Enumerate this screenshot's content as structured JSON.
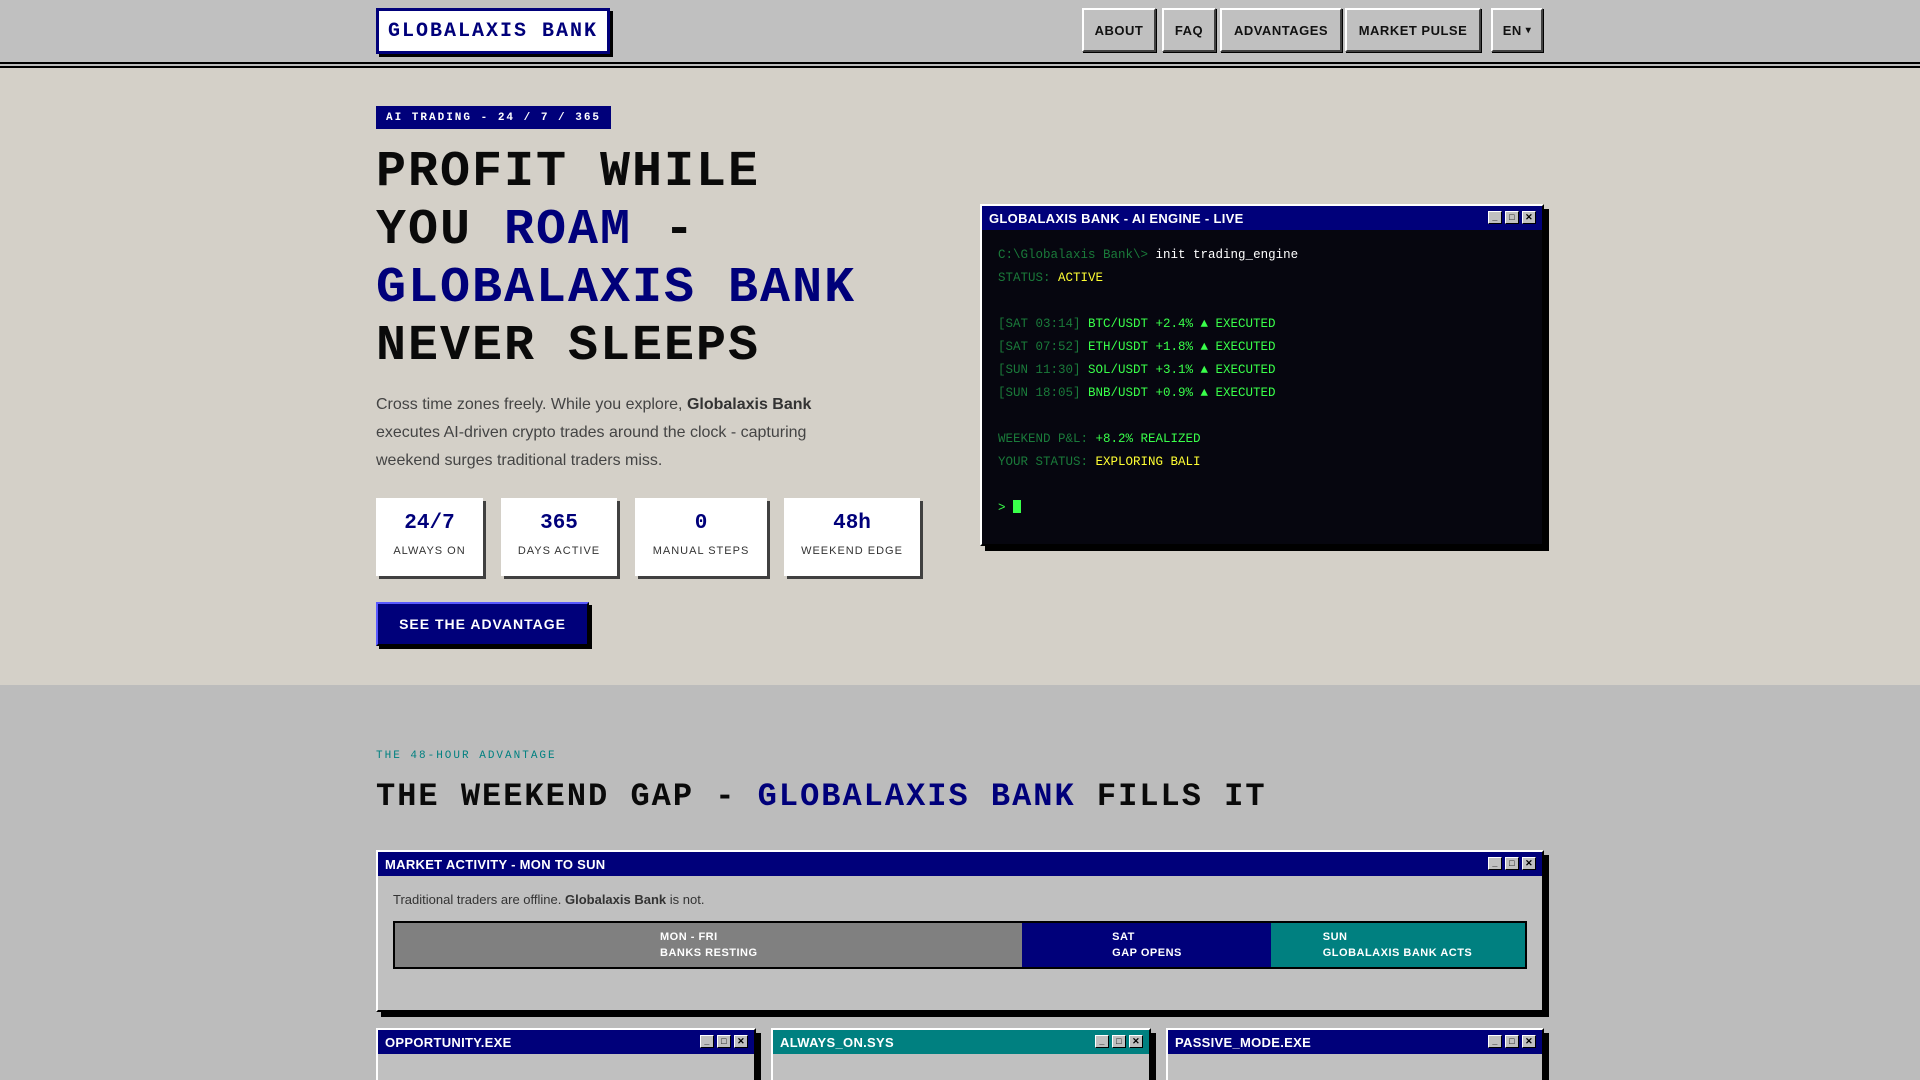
{
  "nav": {
    "logo": "GLOBALAXIS BANK",
    "items": [
      "ABOUT",
      "FAQ",
      "ADVANTAGES",
      "MARKET PULSE"
    ],
    "lang": "EN",
    "lang_arrow": "▾"
  },
  "hero": {
    "tag": "AI TRADING - 24 / 7 / 365",
    "title": {
      "l1": "PROFIT WHILE",
      "l2a": "YOU ",
      "l2b": "ROAM",
      "l2c": " -",
      "l3": "GLOBALAXIS BANK",
      "l4": "NEVER SLEEPS"
    },
    "lead": {
      "a": "Cross time zones freely. While you explore, ",
      "b": "Globalaxis Bank",
      "c": " executes AI-driven crypto trades around the clock - capturing weekend surges traditional traders miss."
    },
    "stats": [
      {
        "value": "24/7",
        "label": "ALWAYS ON"
      },
      {
        "value": "365",
        "label": "DAYS ACTIVE"
      },
      {
        "value": "0",
        "label": "MANUAL STEPS"
      },
      {
        "value": "48h",
        "label": "WEEKEND EDGE"
      }
    ],
    "cta": "SEE THE ADVANTAGE"
  },
  "terminal": {
    "title": "GLOBALAXIS BANK - AI ENGINE - LIVE",
    "prompt": "C:\\Globalaxis Bank\\>",
    "command": "init trading_engine",
    "status_label": "STATUS:",
    "status_value": "ACTIVE",
    "trades": [
      {
        "time": "[SAT 03:14]",
        "text": "BTC/USDT +2.4% ▲ EXECUTED"
      },
      {
        "time": "[SAT 07:52]",
        "text": "ETH/USDT +1.8% ▲ EXECUTED"
      },
      {
        "time": "[SUN 11:30]",
        "text": "SOL/USDT +3.1% ▲ EXECUTED"
      },
      {
        "time": "[SUN 18:05]",
        "text": "BNB/USDT +0.9% ▲ EXECUTED"
      }
    ],
    "pnl_label": "WEEKEND P&L:",
    "pnl_value": "+8.2% REALIZED",
    "your_status_label": "YOUR STATUS:",
    "your_status_value": "EXPLORING BALI",
    "caret": ">"
  },
  "section2": {
    "eyebrow": "THE 48-HOUR ADVANTAGE",
    "title_a": "THE WEEKEND GAP - ",
    "title_b": "GLOBALAXIS BANK",
    "title_c": " FILLS IT",
    "market": {
      "title": "MARKET ACTIVITY - MON TO SUN",
      "sub_a": "Traditional traders are offline. ",
      "sub_b": "Globalaxis Bank",
      "sub_c": " is not.",
      "segments": [
        {
          "top": "MON - FRI",
          "bottom": "BANKS RESTING",
          "color": "#808080",
          "share": 0.555
        },
        {
          "top": "SAT",
          "bottom": "GAP OPENS",
          "color": "#00007a",
          "share": 0.22
        },
        {
          "top": "SUN",
          "bottom": "GLOBALAXIS BANK ACTS",
          "color": "#008080",
          "share": 0.225
        }
      ]
    },
    "windows": [
      {
        "title": "OPPORTUNITY.EXE"
      },
      {
        "title": "ALWAYS_ON.SYS"
      },
      {
        "title": "PASSIVE_MODE.EXE"
      }
    ]
  },
  "colors": {
    "navy": "#00007a",
    "teal": "#008080",
    "terminal_green": "#39ff4a",
    "terminal_yellow": "#ffff33",
    "hero_bg": "#d4d0c8",
    "page_bg": "#bcbcbc"
  },
  "icons": [
    "minimize-icon",
    "maximize-icon",
    "close-icon",
    "chevron-down-icon"
  ]
}
